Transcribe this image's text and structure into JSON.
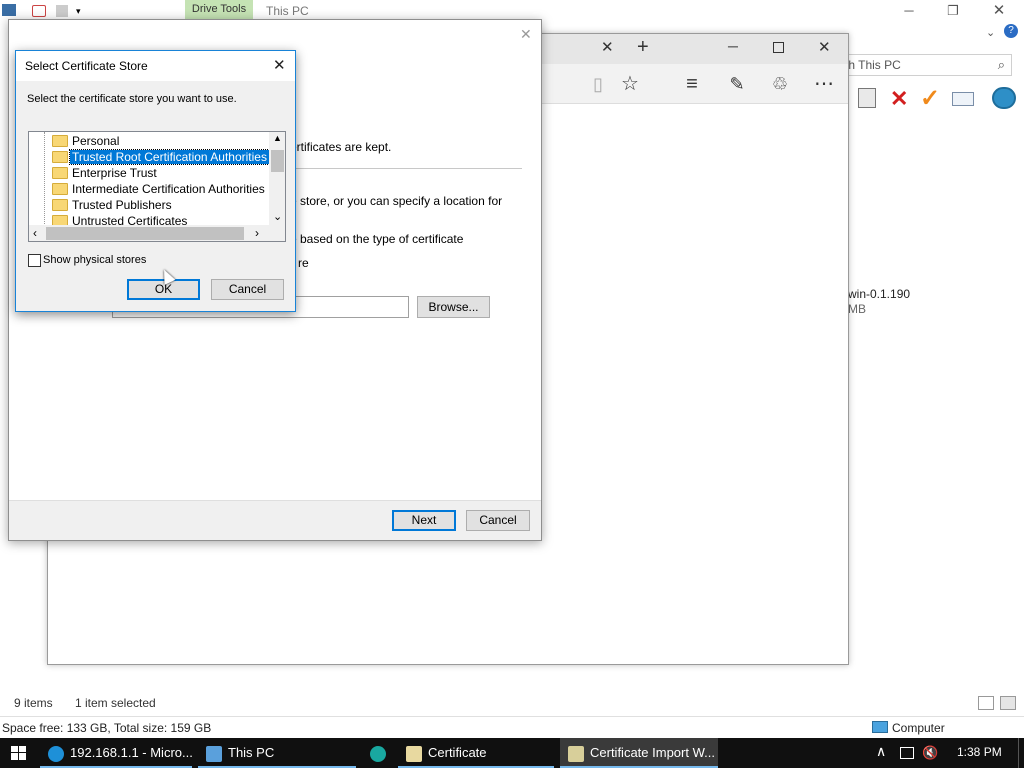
{
  "explorer": {
    "context_tab": "Drive Tools",
    "title": "This PC",
    "search_placeholder": "Search This PC",
    "search_visible": "th This PC",
    "file_name": "win-0.1.190",
    "file_size": "MB",
    "status_items": "9 items",
    "status_selected": "1 item selected",
    "space_info": "Space free: 133 GB, Total size: 159 GB",
    "computer_label": "Computer"
  },
  "wizard": {
    "desc_kept": "ertificates are kept.",
    "desc_store": "e store, or you can specify a location for",
    "desc_based": "e based on the type of certificate",
    "desc_re": "re",
    "browse_label": "Browse...",
    "next_label": "Next",
    "cancel_label": "Cancel"
  },
  "dialog": {
    "title": "Select Certificate Store",
    "instruction": "Select the certificate store you want to use.",
    "stores": [
      "Personal",
      "Trusted Root Certification Authorities",
      "Enterprise Trust",
      "Intermediate Certification Authorities",
      "Trusted Publishers",
      "Untrusted Certificates"
    ],
    "selected_index": 1,
    "show_physical_label": "Show physical stores",
    "ok_label": "OK",
    "cancel_label": "Cancel"
  },
  "taskbar": {
    "items": [
      "192.168.1.1 - Micro...",
      "This PC",
      "",
      "Certificate",
      "Certificate Import W..."
    ],
    "time": "1:38 PM"
  },
  "colors": {
    "accent": "#0078d7",
    "drive_tools": "#c5e3b4",
    "taskbar": "#101010"
  }
}
